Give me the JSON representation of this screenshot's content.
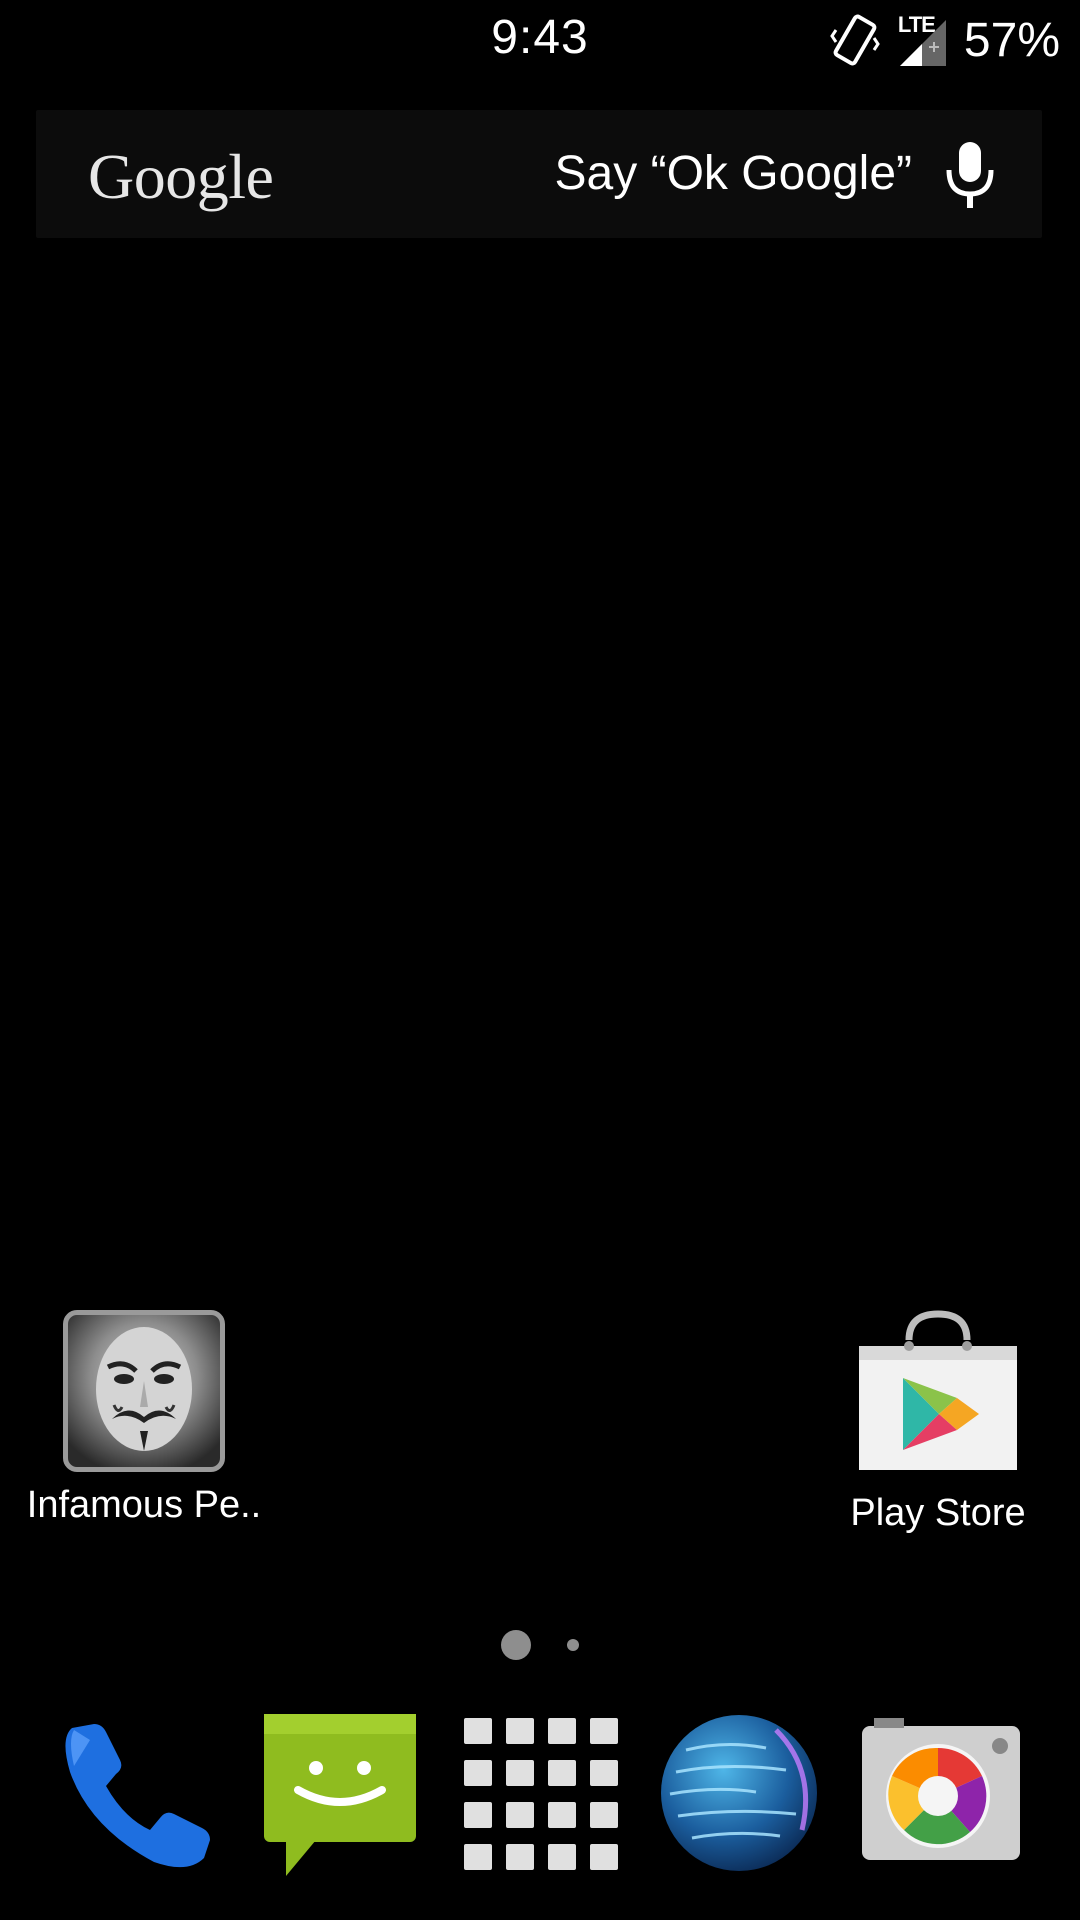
{
  "status_bar": {
    "time": "9:43",
    "network": "LTE",
    "battery": "57%",
    "icons": [
      "vibrate-icon",
      "signal-icon"
    ]
  },
  "search_widget": {
    "logo": "Google",
    "hint": "Say “Ok Google”",
    "mic_icon": "mic-icon"
  },
  "home": {
    "apps": [
      {
        "label": "Infamous Pe..",
        "icon": "anonymous-mask-icon"
      },
      {
        "label": "Play Store",
        "icon": "play-store-icon"
      }
    ],
    "pages": {
      "current": 1,
      "total": 2
    }
  },
  "dock": {
    "items": [
      {
        "name": "phone",
        "icon": "phone-icon"
      },
      {
        "name": "messaging",
        "icon": "messaging-icon"
      },
      {
        "name": "app-drawer",
        "icon": "app-drawer-icon"
      },
      {
        "name": "browser",
        "icon": "globe-icon"
      },
      {
        "name": "camera",
        "icon": "camera-icon"
      }
    ]
  },
  "colors": {
    "background": "#000000",
    "text": "#ffffff",
    "phone_blue": "#1e6fe0",
    "messaging_green": "#8fbc1f"
  }
}
